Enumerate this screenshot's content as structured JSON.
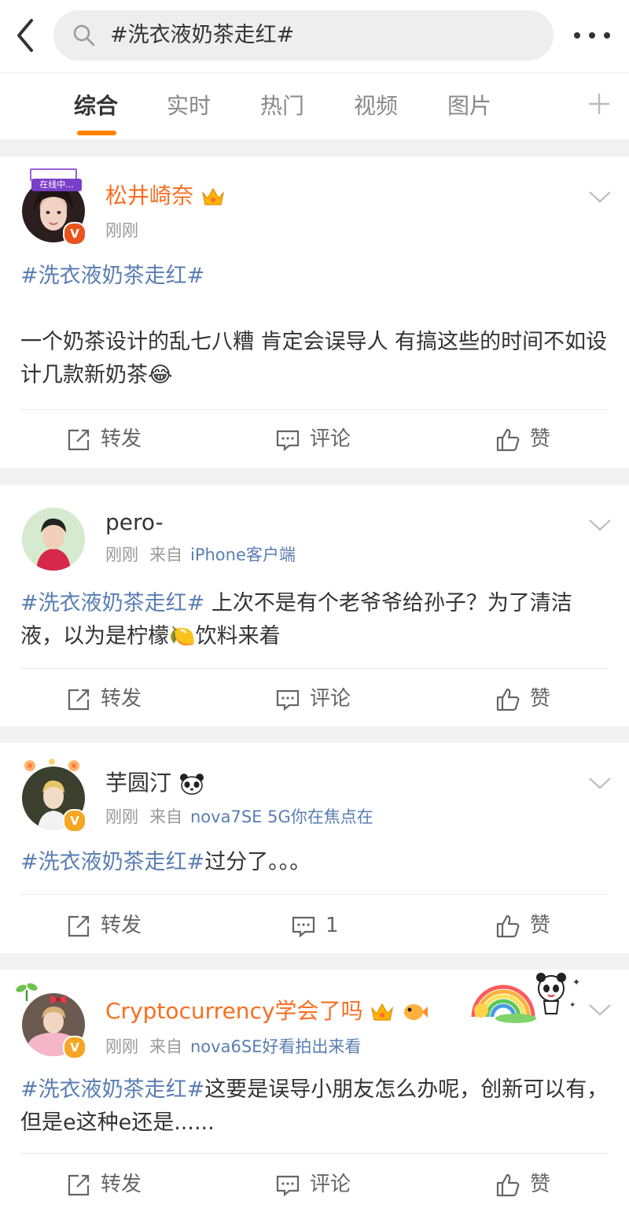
{
  "header": {
    "search_text": "#洗衣液奶茶走红#"
  },
  "tabs": [
    {
      "label": "综合",
      "active": true
    },
    {
      "label": "实时"
    },
    {
      "label": "热门"
    },
    {
      "label": "视频"
    },
    {
      "label": "图片"
    }
  ],
  "accent_color": "#ff8200",
  "link_color": "#5a7eb2",
  "posts": [
    {
      "username": "松井崎奈",
      "avatar_badge": "在线中...",
      "time": "刚刚",
      "hashtag": "#洗衣液奶茶走红#",
      "text": "一个奶茶设计的乱七八糟 肯定会误导人 有搞这些的时间不如设计几款新奶茶😂",
      "actions": {
        "repost": "转发",
        "comment": "评论",
        "like": "赞"
      }
    },
    {
      "username": "pero-",
      "time": "刚刚",
      "from_label": "来自",
      "source": "iPhone客户端",
      "hashtag": "#洗衣液奶茶走红#",
      "text": " 上次不是有个老爷爷给孙子？为了清洁液，以为是柠檬🍋饮料来着",
      "actions": {
        "repost": "转发",
        "comment": "评论",
        "like": "赞"
      }
    },
    {
      "username": "芋圆汀",
      "time": "刚刚",
      "from_label": "来自",
      "source": "nova7SE 5G你在焦点在",
      "hashtag": "#洗衣液奶茶走红#",
      "text": "过分了。。。",
      "actions": {
        "repost": "转发",
        "comment": "1",
        "like": "赞"
      }
    },
    {
      "username": "Cryptocurrency学会了吗",
      "time": "刚刚",
      "from_label": "来自",
      "source": "nova6SE好看拍出来看",
      "hashtag": "#洗衣液奶茶走红#",
      "text": "这要是误导小朋友怎么办呢，创新可以有，但是e这种e还是......",
      "actions": {
        "repost": "转发",
        "comment": "评论",
        "like": "赞"
      }
    }
  ]
}
